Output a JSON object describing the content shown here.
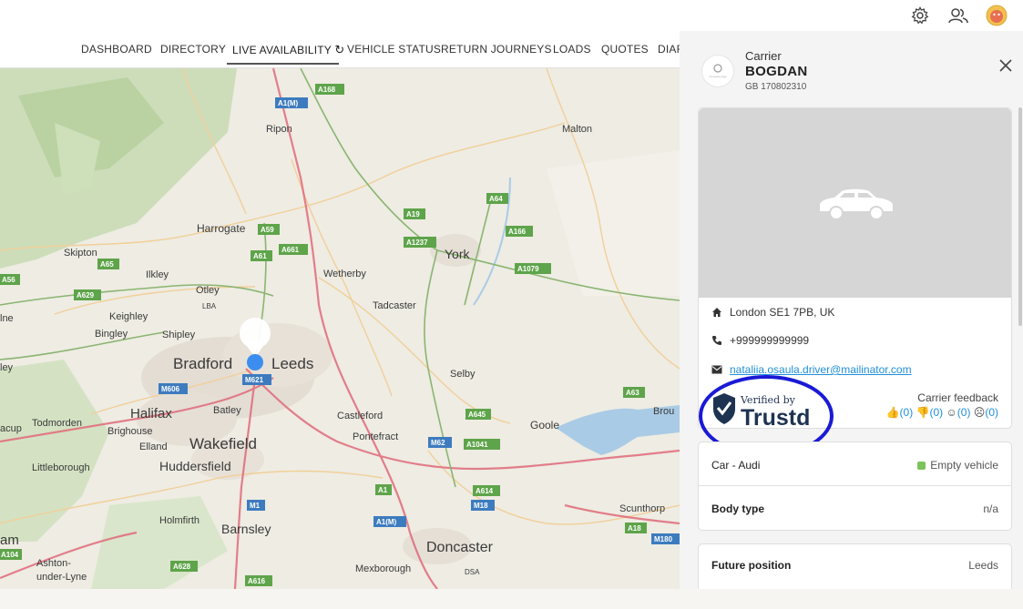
{
  "topbar": {
    "icons": [
      "gear-icon",
      "users-icon",
      "avatar"
    ]
  },
  "nav": {
    "tabs": [
      {
        "label": "DASHBOARD"
      },
      {
        "label": "DIRECTORY"
      },
      {
        "label": "LIVE AVAILABILITY"
      },
      {
        "label": "VEHICLE STATUS"
      },
      {
        "label": "RETURN JOURNEYS"
      },
      {
        "label": "LOADS"
      },
      {
        "label": "QUOTES"
      },
      {
        "label": "DIAR"
      }
    ],
    "active_tab": "LIVE AVAILABILITY",
    "refresh_icon": "↻"
  },
  "map": {
    "towns": [
      {
        "name": "Ripon"
      },
      {
        "name": "Malton"
      },
      {
        "name": "Harrogate"
      },
      {
        "name": "York"
      },
      {
        "name": "Skipton"
      },
      {
        "name": "Ilkley"
      },
      {
        "name": "Otley"
      },
      {
        "name": "Wetherby"
      },
      {
        "name": "Tadcaster"
      },
      {
        "name": "Keighley"
      },
      {
        "name": "LBA"
      },
      {
        "name": "Bingley"
      },
      {
        "name": "Shipley"
      },
      {
        "name": "Bradford"
      },
      {
        "name": "Leeds"
      },
      {
        "name": "Selby"
      },
      {
        "name": "Batley"
      },
      {
        "name": "Halifax"
      },
      {
        "name": "Castleford"
      },
      {
        "name": "Todmorden"
      },
      {
        "name": "Brighouse"
      },
      {
        "name": "Elland"
      },
      {
        "name": "Wakefield"
      },
      {
        "name": "Pontefract"
      },
      {
        "name": "Goole"
      },
      {
        "name": "Littleborough"
      },
      {
        "name": "Huddersfield"
      },
      {
        "name": "Holmfirth"
      },
      {
        "name": "Barnsley"
      },
      {
        "name": "Scunthorp"
      },
      {
        "name": "Doncaster"
      },
      {
        "name": "Ashton-"
      },
      {
        "name": "under-Lyne"
      },
      {
        "name": "Mexborough"
      },
      {
        "name": "DSA"
      },
      {
        "name": "ley"
      },
      {
        "name": "lne"
      },
      {
        "name": "acup"
      },
      {
        "name": "am"
      },
      {
        "name": "Brou"
      }
    ],
    "roads": [
      {
        "name": "A168"
      },
      {
        "name": "A1(M)"
      },
      {
        "name": "A64"
      },
      {
        "name": "A19"
      },
      {
        "name": "A1237"
      },
      {
        "name": "A166"
      },
      {
        "name": "A59"
      },
      {
        "name": "A661"
      },
      {
        "name": "A61"
      },
      {
        "name": "A65"
      },
      {
        "name": "A1079"
      },
      {
        "name": "A56"
      },
      {
        "name": "A629"
      },
      {
        "name": "M606"
      },
      {
        "name": "M621"
      },
      {
        "name": "A63"
      },
      {
        "name": "A645"
      },
      {
        "name": "M62"
      },
      {
        "name": "A1041"
      },
      {
        "name": "A614"
      },
      {
        "name": "A1"
      },
      {
        "name": "M18"
      },
      {
        "name": "M1"
      },
      {
        "name": "A1(M)"
      },
      {
        "name": "A18"
      },
      {
        "name": "A628"
      },
      {
        "name": "A616"
      },
      {
        "name": "M180"
      },
      {
        "name": "A104"
      }
    ]
  },
  "panel": {
    "carrier_label": "Carrier",
    "carrier_name": "BOGDAN",
    "carrier_reg": "GB 170802310",
    "logo_text": "Company logo",
    "close_label": "×",
    "address": "London SE1 7PB, UK",
    "phone": "+999999999999",
    "email": "nataliia.osaula.driver@mailinator.com",
    "trust_badge": {
      "verified_by": "Verified by",
      "brand": "Trustd"
    },
    "feedback_label": "Carrier feedback",
    "feedback": {
      "thumbs_up": "(0)",
      "thumbs_down": "(0)",
      "neutral": "(0)",
      "sad": "(0)"
    },
    "vehicle": {
      "title": "Car - Audi",
      "status": "Empty vehicle",
      "status_color": "#7cc35b"
    },
    "body_type": {
      "title": "Body type",
      "value": "n/a"
    },
    "future_position": {
      "title": "Future position",
      "value": "Leeds"
    }
  }
}
